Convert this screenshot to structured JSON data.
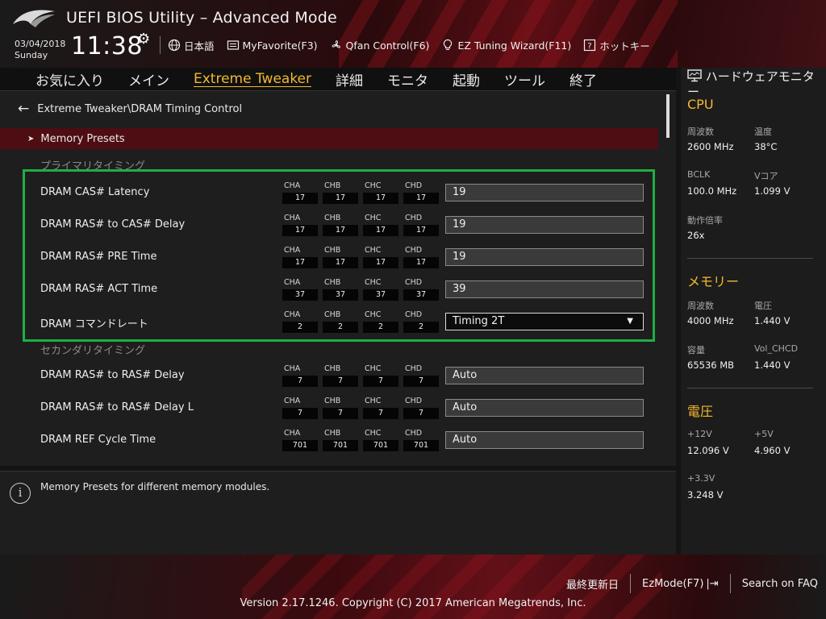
{
  "header": {
    "title": "UEFI BIOS Utility – Advanced Mode",
    "date": "03/04/2018",
    "day": "Sunday",
    "time": "11:38",
    "toolbar": {
      "language": "日本語",
      "myfavorite": "MyFavorite(F3)",
      "qfan": "Qfan Control(F6)",
      "ez_tuning": "EZ Tuning Wizard(F11)",
      "hotkeys": "ホットキー"
    }
  },
  "nav": {
    "tabs": [
      {
        "label": "お気に入り"
      },
      {
        "label": "メイン"
      },
      {
        "label": "Extreme Tweaker",
        "active": true
      },
      {
        "label": "詳細"
      },
      {
        "label": "モニタ"
      },
      {
        "label": "起動"
      },
      {
        "label": "ツール"
      },
      {
        "label": "終了"
      }
    ]
  },
  "main": {
    "breadcrumb": "Extreme Tweaker\\DRAM Timing Control",
    "presets_label": "Memory Presets",
    "primary_label": "プライマリタイミング",
    "secondary_label": "セカンダリタイミング",
    "channels": [
      "CHA",
      "CHB",
      "CHC",
      "CHD"
    ],
    "rows": [
      {
        "label": "DRAM CAS# Latency",
        "ch": [
          "17",
          "17",
          "17",
          "17"
        ],
        "value": "19"
      },
      {
        "label": "DRAM RAS# to CAS# Delay",
        "ch": [
          "17",
          "17",
          "17",
          "17"
        ],
        "value": "19"
      },
      {
        "label": "DRAM RAS# PRE Time",
        "ch": [
          "17",
          "17",
          "17",
          "17"
        ],
        "value": "19"
      },
      {
        "label": "DRAM RAS# ACT Time",
        "ch": [
          "37",
          "37",
          "37",
          "37"
        ],
        "value": "39"
      },
      {
        "label": "DRAM コマンドレート",
        "ch": [
          "2",
          "2",
          "2",
          "2"
        ],
        "value": "Timing 2T"
      },
      {
        "label": "DRAM RAS# to RAS# Delay",
        "ch": [
          "7",
          "7",
          "7",
          "7"
        ],
        "value": "Auto"
      },
      {
        "label": "DRAM RAS# to RAS# Delay L",
        "ch": [
          "7",
          "7",
          "7",
          "7"
        ],
        "value": "Auto"
      },
      {
        "label": "DRAM REF Cycle Time",
        "ch": [
          "701",
          "701",
          "701",
          "701"
        ],
        "value": "Auto"
      }
    ]
  },
  "help": {
    "text": "Memory Presets for different memory modules."
  },
  "hardware_monitor": {
    "title": "ハードウェアモニター",
    "cpu": {
      "heading": "CPU",
      "freq_label": "周波数",
      "freq": "2600 MHz",
      "temp_label": "温度",
      "temp": "38°C",
      "bclk_label": "BCLK",
      "bclk": "100.0 MHz",
      "vcore_label": "Vコア",
      "vcore": "1.099 V",
      "ratio_label": "動作倍率",
      "ratio": "26x"
    },
    "memory": {
      "heading": "メモリー",
      "freq_label": "周波数",
      "freq": "4000 MHz",
      "volt_label": "電圧",
      "volt": "1.440 V",
      "cap_label": "容量",
      "cap": "65536 MB",
      "vol_chcd_label": "Vol_CHCD",
      "vol_chcd": "1.440 V"
    },
    "voltage": {
      "heading": "電圧",
      "v12_label": "+12V",
      "v12": "12.096 V",
      "v5_label": "+5V",
      "v5": "4.960 V",
      "v33_label": "+3.3V",
      "v33": "3.248 V"
    }
  },
  "footer": {
    "last_modified": "最終更新日",
    "ezmode": "EzMode(F7)",
    "search_faq": "Search on FAQ",
    "copyright": "Version 2.17.1246. Copyright (C) 2017 American Megatrends, Inc."
  }
}
